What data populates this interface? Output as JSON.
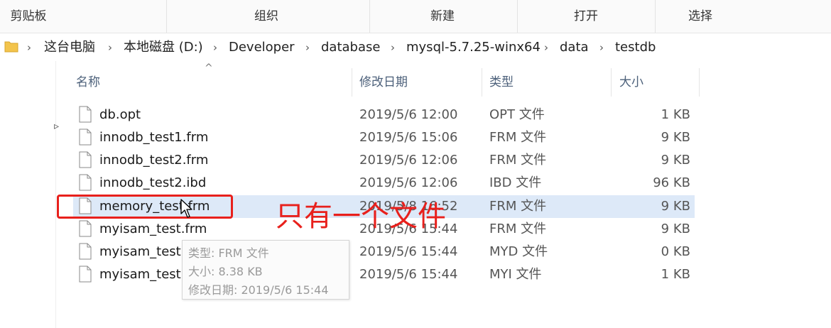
{
  "ribbon": {
    "groups": [
      "剪贴板",
      "组织",
      "新建",
      "打开",
      "选择"
    ]
  },
  "address": {
    "icon": "folder-icon",
    "crumbs": [
      "这台电脑",
      "本地磁盘 (D:)",
      "Developer",
      "database",
      "mysql-5.7.25-winx64",
      "data",
      "testdb"
    ]
  },
  "columns": {
    "name": "名称",
    "modified": "修改日期",
    "type": "类型",
    "size": "大小"
  },
  "files": [
    {
      "name": "db.opt",
      "modified": "2019/5/6 12:00",
      "type": "OPT 文件",
      "size": "1 KB"
    },
    {
      "name": "innodb_test1.frm",
      "modified": "2019/5/6 15:06",
      "type": "FRM 文件",
      "size": "9 KB"
    },
    {
      "name": "innodb_test2.frm",
      "modified": "2019/5/6 12:06",
      "type": "FRM 文件",
      "size": "9 KB"
    },
    {
      "name": "innodb_test2.ibd",
      "modified": "2019/5/6 12:06",
      "type": "IBD 文件",
      "size": "96 KB"
    },
    {
      "name": "memory_test.frm",
      "modified": "2019/5/8 16:52",
      "type": "FRM 文件",
      "size": "9 KB"
    },
    {
      "name": "myisam_test.frm",
      "modified": "2019/5/6 15:44",
      "type": "FRM 文件",
      "size": "9 KB"
    },
    {
      "name": "myisam_test.MYD",
      "modified": "2019/5/6 15:44",
      "type": "MYD 文件",
      "size": "0 KB"
    },
    {
      "name": "myisam_test.MYI",
      "modified": "2019/5/6 15:44",
      "type": "MYI 文件",
      "size": "1 KB"
    }
  ],
  "tooltip": {
    "type_line": "类型: FRM 文件",
    "size_line": "大小: 8.38 KB",
    "modified_line": "修改日期: 2019/5/6 15:44"
  },
  "annotation": {
    "text": "只有一个文件",
    "color": "#e8201c"
  },
  "colors": {
    "selected_row": "#dde9f8",
    "header_text": "#4c607a"
  }
}
